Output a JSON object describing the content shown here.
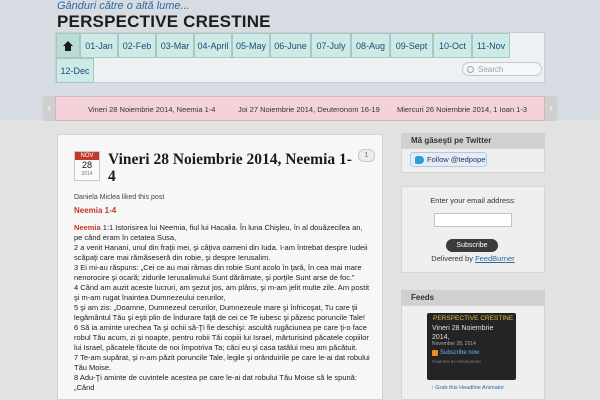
{
  "header": {
    "tagline": "Gânduri către o altă lume...",
    "site_title": "PERSPECTIVE CRESTINE"
  },
  "nav": {
    "home_icon": "home-icon",
    "items": [
      "01-Jan",
      "02-Feb",
      "03-Mar",
      "04-April",
      "05-May",
      "06-June",
      "07-July",
      "08-Aug",
      "09-Sept",
      "10-Oct",
      "11-Nov",
      "12-Dec"
    ],
    "search_placeholder": "Search"
  },
  "ticker": {
    "items": [
      "Vineri 28 Noiembrie 2014, Neemia 1-4",
      "Joi 27 Noiembrie 2014, Deuteronom 16-19",
      "Miercuri 26 Noiembrie 2014, 1 Ioan 1-3"
    ],
    "left_arrow": "‹",
    "right_arrow": "›"
  },
  "post": {
    "month": "NOV",
    "day": "28",
    "year": "2014",
    "title": "Vineri 28 Noiembrie 2014, Neemia 1-4",
    "comments": "1",
    "liked": "Daniela Miclea liked this post",
    "subtitle": "Neemia 1-4",
    "paragraphs": [
      {
        "hl": "Neemia",
        "text": " 1:1  Istorisirea lui Neemia, fiul lui Hacalia. În luna Chişleu, în al douăzecilea an, pe când eram în cetatea Susa,"
      },
      {
        "hl": "",
        "text": "2  a venit Hanani, unul din fraţii mei, şi câţiva oameni din Iuda. I-am întrebat despre Iudeii scăpaţi care mai rămăseseră din robie, şi despre Ierusalim."
      },
      {
        "hl": "",
        "text": "3  Ei mi-au răspuns: „Cei ce au mai rămas din robie Sunt acolo în ţară, în cea mai mare nenorocire şi ocară; zidurile Ierusalimului Sunt dărâmate, şi porţile Sunt arse de foc.”"
      },
      {
        "hl": "",
        "text": "4  Când am auzit aceste lucruri, am şezut jos, am plâns, şi m-am jelit multe zile. Am postit şi m-am rugat înaintea Dumnezeului cerurilor,"
      },
      {
        "hl": "",
        "text": "5  şi am zis: „Doamne, Dumnezeul cerurilor, Dumnezeule mare şi înfricoşat, Tu care ţii legământul Tău şi eşti plin de îndurare faţă de cei ce Te iubesc şi păzesc poruncile Tale!"
      },
      {
        "hl": "",
        "text": "6  Să ia aminte urechea Ta şi ochii să-Ţi fie deschişi: ascultă rugăciunea pe care ţi-o face robul Tău acum, zi şi noapte, pentru robii Tăi copiii lui Israel, mărturisind păcatele copiilor lui Israel, păcatele făcute de noi împotriva Ta; căci eu şi casa tatălui meu am păcătuit."
      },
      {
        "hl": "",
        "text": "7  Te-am supărat, şi n-am păzit poruncile Tale, legile şi orânduirile pe care le-ai dat robului Tău Moise."
      },
      {
        "hl": "",
        "text": "8  Adu-Ţi aminte de cuvintele acestea pe care le-ai dat robului Tău Moise să le spună: „Când"
      }
    ]
  },
  "sidebar": {
    "twitter_heading": "Mă găseşti pe Twitter",
    "follow_label": "Follow @tedpope",
    "email_label": "Enter your email address:",
    "subscribe_label": "Subscribe",
    "delivered_prefix": "Delivered by ",
    "delivered_link": "FeedBurner",
    "feeds_heading": "Feeds",
    "feed_title": "PERSPECTIVE CRESTINE",
    "feed_entry": "Vineri 28 Noiembrie 2014,",
    "feed_date": "November 28, 2014",
    "feed_subscribe": "Subscribe now",
    "feed_powered": "POWERED BY FEEDBURNER",
    "grab_link": "↑ Grab this Headline Animator"
  },
  "colors": {
    "nav_tab": "#cdebe6",
    "ticker_bg": "#f3d3d9",
    "accent_red": "#c0392b",
    "link_blue": "#2a6aa0"
  }
}
